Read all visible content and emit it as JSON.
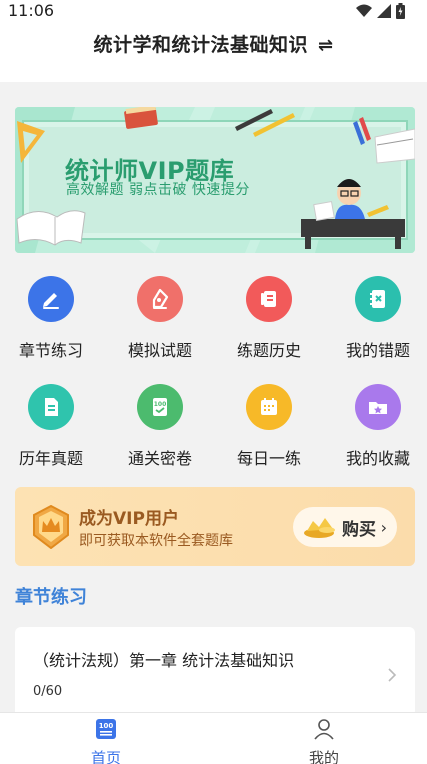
{
  "status": {
    "time": "11:06"
  },
  "header": {
    "title": "统计学和统计法基础知识",
    "swap_icon": "⇌"
  },
  "banner": {
    "title": "统计师VIP题库",
    "subtitle": "高效解题 弱点击破 快速提分"
  },
  "menu": [
    {
      "label": "章节练习",
      "icon": "edit-icon",
      "color": "#3c74e8"
    },
    {
      "label": "模拟试题",
      "icon": "pen-icon",
      "color": "#f0706a"
    },
    {
      "label": "练题历史",
      "icon": "history-book-icon",
      "color": "#f25a5a"
    },
    {
      "label": "我的错题",
      "icon": "error-notebook-icon",
      "color": "#2bbfae"
    },
    {
      "label": "历年真题",
      "icon": "document-icon",
      "color": "#2fc4ad"
    },
    {
      "label": "通关密卷",
      "icon": "score-paper-icon",
      "color": "#4cbb6e"
    },
    {
      "label": "每日一练",
      "icon": "calendar-icon",
      "color": "#f7b928"
    },
    {
      "label": "我的收藏",
      "icon": "star-folder-icon",
      "color": "#a979ec"
    }
  ],
  "vip": {
    "title": "成为VIP用户",
    "subtitle": "即可获取本软件全套题库",
    "button_label": "购买",
    "color": "#9a5a21"
  },
  "section": {
    "title": "章节练习",
    "color": "#3f83d8"
  },
  "chapter_card": {
    "title": "（统计法规）第一章 统计法基础知识",
    "progress": "0/60"
  },
  "tabbar": {
    "tabs": [
      {
        "label": "首页",
        "icon": "home-100-icon",
        "active": true
      },
      {
        "label": "我的",
        "icon": "user-icon",
        "active": false
      }
    ],
    "active_color": "#3c74e8"
  }
}
